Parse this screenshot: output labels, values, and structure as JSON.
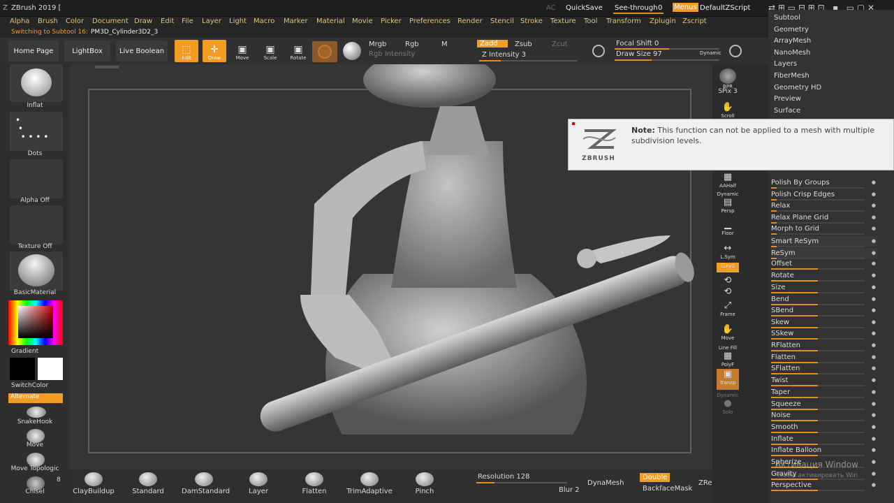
{
  "titlebar": {
    "app": "ZBrush 2019 [",
    "ac": "AC",
    "quicksave": "QuickSave",
    "seethrough": "See-through",
    "seethrough_val": "0",
    "menus": "Menus",
    "script": "DefaultZScript"
  },
  "menubar": [
    "Alpha",
    "Brush",
    "Color",
    "Document",
    "Draw",
    "Edit",
    "File",
    "Layer",
    "Light",
    "Macro",
    "Marker",
    "Material",
    "Movie",
    "Picker",
    "Preferences",
    "Render",
    "Stencil",
    "Stroke",
    "Texture",
    "Tool",
    "Transform",
    "Zplugin",
    "Zscript"
  ],
  "subline": {
    "switching": "Switching to Subtool 16:",
    "name": "PM3D_Cylinder3D2_3"
  },
  "toolbar": {
    "home": "Home Page",
    "lightbox": "LightBox",
    "liveboolean": "Live Boolean",
    "edit": "Edit",
    "draw": "Draw",
    "move": "Move",
    "scale": "Scale",
    "rotate": "Rotate",
    "mrgb": "Mrgb",
    "rgb": "Rgb",
    "m": "M",
    "rgb_intensity": "Rgb Intensity",
    "zadd": "Zadd",
    "zsub": "Zsub",
    "zcut": "Zcut",
    "z_intensity": "Z Intensity 3",
    "focal_shift": "Focal Shift 0",
    "draw_size": "Draw Size 97",
    "dynamic": "Dynamic"
  },
  "left": {
    "inflat": "Inflat",
    "dots": "Dots",
    "alpha_off": "Alpha Off",
    "texture_off": "Texture Off",
    "basicmaterial": "BasicMaterial",
    "gradient": "Gradient",
    "switchcolor": "SwitchColor",
    "alternate": "Alternate",
    "snakehook": "SnakeHook",
    "move": "Move",
    "move_topologic": "Move Topologic",
    "chisel": "Chisel",
    "chisel_num": "8"
  },
  "bottom": {
    "brushes": [
      "ClayBuildup",
      "Standard",
      "DamStandard",
      "Layer",
      "Flatten",
      "TrimAdaptive",
      "Pinch"
    ],
    "resolution": "Resolution 128",
    "blur": "Blur 2",
    "dynamesh": "DynaMesh",
    "double": "Double",
    "backfacemask": "BackfaceMask",
    "zremesh": "ZRer"
  },
  "shelf": {
    "bpr": "BPR",
    "spix": "SPix 3",
    "scroll": "Scroll",
    "aahalf": "AAHalf",
    "dynamic": "Dynamic",
    "persp": "Persp",
    "floor": "Floor",
    "lsym": "L.Sym",
    "xyz": "Gxyz",
    "frame": "Frame",
    "move": "Move",
    "linefill": "Line Fill",
    "polyf": "PolyF",
    "transp": "Transp",
    "dynamic2": "Dynamic",
    "solo": "Solo"
  },
  "rightpanel": {
    "top": [
      "Subtool",
      "Geometry",
      "ArrayMesh",
      "NanoMesh",
      "Layers",
      "FiberMesh",
      "Geometry HD",
      "Preview",
      "Surface"
    ],
    "deform": [
      "Polish By Groups",
      "Polish Crisp Edges",
      "Relax",
      "Relax Plane Grid",
      "Morph to Grid",
      "Smart ReSym",
      "ReSym",
      "Offset",
      "Rotate",
      "Size",
      "Bend",
      "SBend",
      "Skew",
      "SSkew",
      "RFlatten",
      "Flatten",
      "SFlatten",
      "Twist",
      "Taper",
      "Squeeze",
      "Noise",
      "Smooth",
      "Inflate",
      "Inflate Balloon",
      "Spherize",
      "Gravity",
      "Perspective"
    ]
  },
  "note": {
    "label": "Note:",
    "text": "This function can not be applied to a mesh with multiple subdivision levels.",
    "logo": "ZBRUSH"
  },
  "watermark": {
    "line1": "Активация Window",
    "line2": "Чтобы активировать Win"
  },
  "colors": {
    "accent": "#f39b23",
    "menu_text": "#e2c27a",
    "note_bg": "#f0f0f0"
  }
}
